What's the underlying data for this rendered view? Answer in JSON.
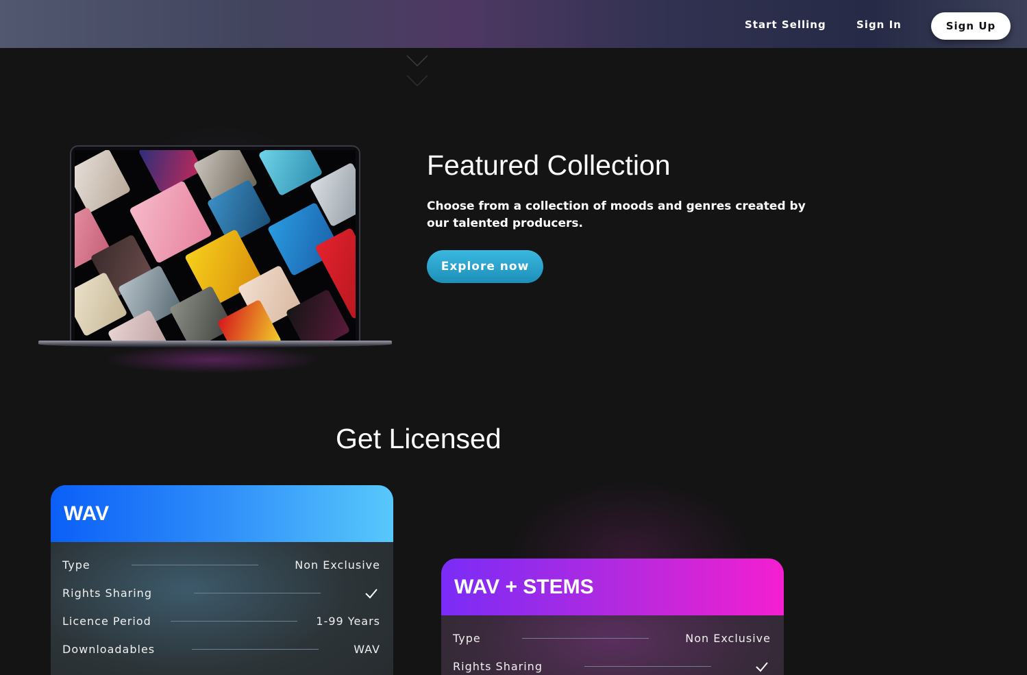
{
  "nav": {
    "start_selling": "Start Selling",
    "sign_in": "Sign In",
    "sign_up": "Sign Up"
  },
  "featured": {
    "title": "Featured Collection",
    "subtitle": "Choose from a collection of moods and genres created by our talented producers.",
    "cta": "Explore now"
  },
  "licenses": {
    "title": "Get Licensed",
    "cards": [
      {
        "name": "WAV",
        "rows": [
          {
            "label": "Type",
            "value": "Non Exclusive"
          },
          {
            "label": "Rights Sharing",
            "value": "check"
          },
          {
            "label": "Licence Period",
            "value": "1-99 Years"
          },
          {
            "label": "Downloadables",
            "value": "WAV"
          }
        ]
      },
      {
        "name": "WAV + STEMS",
        "rows": [
          {
            "label": "Type",
            "value": "Non Exclusive"
          },
          {
            "label": "Rights Sharing",
            "value": "check"
          }
        ]
      }
    ]
  },
  "colors": {
    "background": "#141414",
    "wav_gradient_start": "#0b5ff7",
    "wav_gradient_end": "#57c8fb",
    "stems_gradient_start": "#7a2cf6",
    "stems_gradient_end": "#f41fd0",
    "explore_button": "#2aa6d2"
  }
}
